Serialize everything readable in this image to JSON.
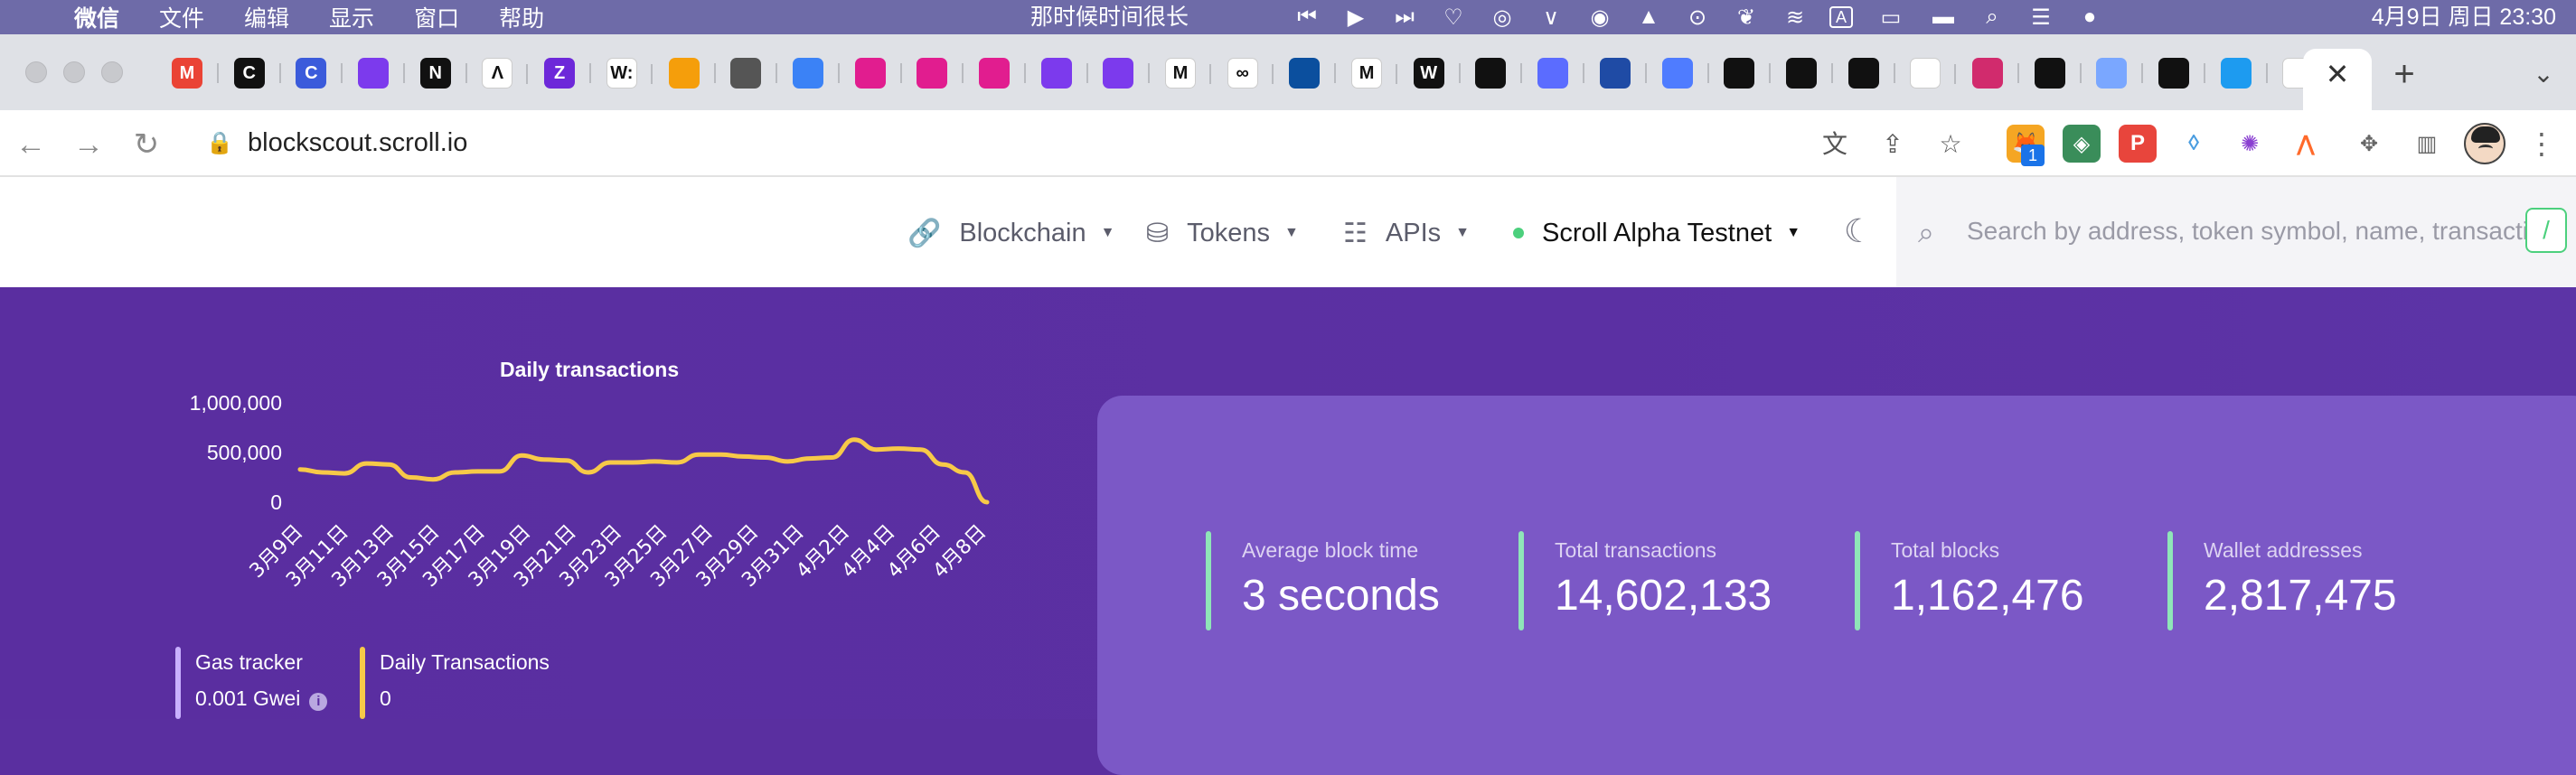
{
  "os_menubar": {
    "app_name": "微信",
    "menus": [
      "文件",
      "编辑",
      "显示",
      "窗口",
      "帮助"
    ],
    "now_playing": "那时候时间很长",
    "clock": "4月9日 周日 23:30",
    "input_indicator": "A"
  },
  "browser": {
    "tab_favicon_letters": [
      "M",
      "C",
      "C",
      "",
      "N",
      "Λ",
      "Z",
      "W:",
      "",
      "",
      "",
      "",
      "",
      "",
      "",
      "",
      "M",
      "∞",
      "",
      "M",
      "W",
      "",
      "",
      "",
      "",
      "",
      "",
      "",
      "",
      "",
      "",
      "",
      "",
      "",
      ""
    ],
    "tab_colors": [
      "#ea4335",
      "#111111",
      "#3b5bdb",
      "#7c3aed",
      "#111111",
      "#ffffff",
      "#6d28d9",
      "#ffffff",
      "#f59e0b",
      "#555555",
      "#3b82f6",
      "#e11d8f",
      "#e11d8f",
      "#e11d8f",
      "#7c3aed",
      "#7c3aed",
      "#ffffff",
      "#ffffff",
      "#0b4f9e",
      "#ffffff",
      "#111111",
      "#111111",
      "#5b6cff",
      "#1f4ba5",
      "#4f7cff",
      "#111111",
      "#111111",
      "#111111",
      "#ffffff",
      "#d12b6d",
      "#111111",
      "#7aa7ff",
      "#111111",
      "#1d9bf0",
      "#ffffff"
    ],
    "active_tab_close": "✕",
    "new_tab": "+",
    "url": "blockscout.scroll.io",
    "extension_badge": "1"
  },
  "site_header": {
    "nav": [
      {
        "label": "Blockchain",
        "icon": "link-icon"
      },
      {
        "label": "Tokens",
        "icon": "coins-icon"
      },
      {
        "label": "APIs",
        "icon": "sliders-icon"
      }
    ],
    "network": "Scroll Alpha Testnet",
    "network_status_color": "#4cd07d",
    "search_placeholder": "Search by address, token symbol, name, transaction hash, or block number",
    "search_shortcut": "/"
  },
  "hero": {
    "chart_data": {
      "type": "line",
      "title": "Daily transactions",
      "xlabel": "",
      "ylabel": "",
      "ylim": [
        0,
        1000000
      ],
      "y_ticks": [
        "1,000,000",
        "500,000",
        "0"
      ],
      "x_tick_labels": [
        "3月9日",
        "3月11日",
        "3月13日",
        "3月15日",
        "3月17日",
        "3月19日",
        "3月21日",
        "3月23日",
        "3月25日",
        "3月27日",
        "3月29日",
        "3月31日",
        "4月2日",
        "4月4日",
        "4月6日",
        "4月8日"
      ],
      "series": [
        {
          "color": "#f7c948",
          "x": [
            "3月9日",
            "3月10日",
            "3月11日",
            "3月12日",
            "3月13日",
            "3月14日",
            "3月15日",
            "3月16日",
            "3月17日",
            "3月18日",
            "3月19日",
            "3月20日",
            "3月21日",
            "3月22日",
            "3月23日",
            "3月24日",
            "3月25日",
            "3月26日",
            "3月27日",
            "3月28日",
            "3月29日",
            "3月30日",
            "3月31日",
            "4月1日",
            "4月2日",
            "4月3日",
            "4月4日",
            "4月5日",
            "4月6日",
            "4月7日",
            "4月8日",
            "4月9日"
          ],
          "values": [
            330000,
            300000,
            290000,
            390000,
            380000,
            250000,
            230000,
            300000,
            310000,
            310000,
            470000,
            430000,
            420000,
            300000,
            400000,
            400000,
            410000,
            400000,
            480000,
            480000,
            460000,
            450000,
            410000,
            440000,
            450000,
            630000,
            530000,
            540000,
            530000,
            380000,
            300000,
            0
          ]
        }
      ],
      "grid": false,
      "legend": "none"
    },
    "stats": [
      {
        "label": "Average block time",
        "value": "3 seconds"
      },
      {
        "label": "Total transactions",
        "value": "14,602,133"
      },
      {
        "label": "Total blocks",
        "value": "1,162,476"
      },
      {
        "label": "Wallet addresses",
        "value": "2,817,475"
      }
    ],
    "mini_stats": [
      {
        "label": "Gas tracker",
        "value": "0.001 Gwei",
        "color": "#c9b0ff"
      },
      {
        "label": "Daily Transactions",
        "value": "0",
        "color": "#f7c948"
      }
    ]
  }
}
